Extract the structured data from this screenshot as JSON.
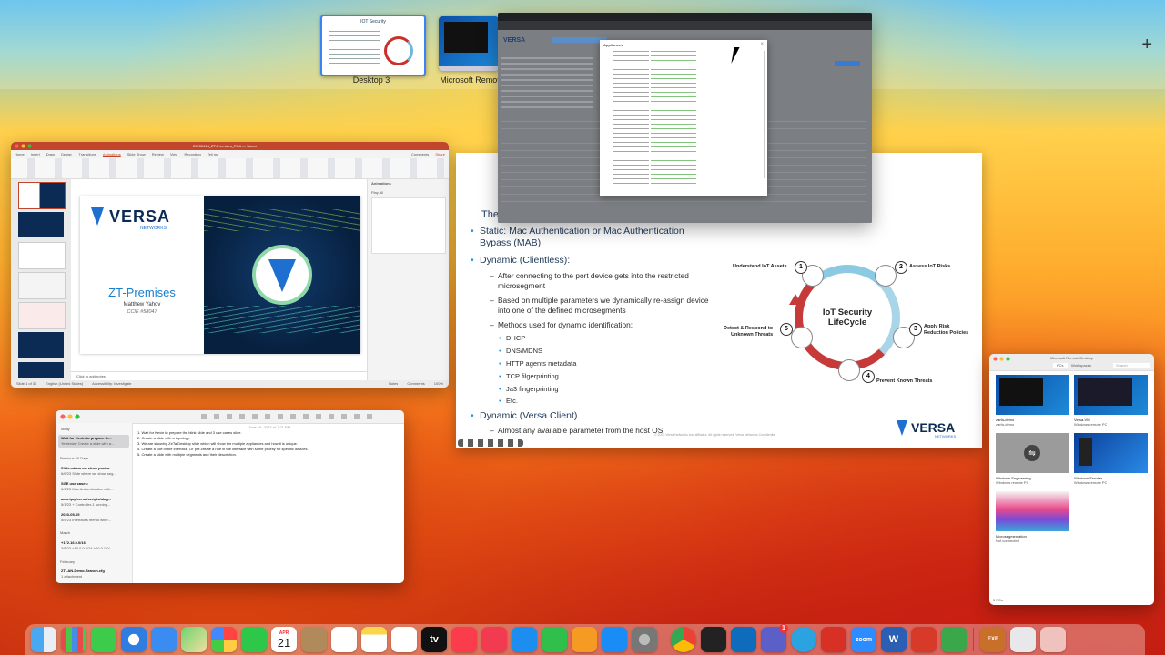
{
  "spaces": {
    "desktop3_label": "Desktop 3",
    "desktop3_thumb_title": "IOT Security",
    "remote_label": "Microsoft Remot",
    "add_space": "+"
  },
  "powerpoint": {
    "title": "20230418_ZT-Premises_RSA — Saved",
    "menu": [
      "Home",
      "Insert",
      "Draw",
      "Design",
      "Transitions",
      "Animations",
      "Slide Show",
      "Review",
      "View",
      "Recording",
      "Tell me"
    ],
    "comments": "Comments",
    "share": "Share",
    "pane_title": "Animations",
    "pane_play": "Play All",
    "slide_title": "ZT-Premises",
    "slide_author": "Matthew Yahov",
    "slide_ccie": "CCIE #58047",
    "notes_placeholder": "Click to add notes",
    "status_left": "Slide 1 of 30",
    "status_lang": "English (United States)",
    "status_access": "Accessibility: Investigate",
    "status_notes": "Notes",
    "status_comments": "Comments",
    "zoom": "100%",
    "logo_text": "VERSA",
    "logo_sub": "NETWORKS"
  },
  "slide": {
    "heading_partial": "The",
    "b1_line1": "Static: Mac Authentication or Mac Authentication",
    "b1_line2": "Bypass (MAB)",
    "b2": "Dynamic (Clientless):",
    "s1_line1": "After connecting to the port device gets into the restricted",
    "s1_line2": "microsegment",
    "s2_line1": "Based on multiple parameters we dynamically re-assign device",
    "s2_line2": "into one of the defined microsegments",
    "s3": "Methods used for dynamic identification:",
    "m1": "DHCP",
    "m2": "DNS/MDNS",
    "m3": "HTTP agents metadata",
    "m4": "TCP filgerprinting",
    "m5": "Ja3 fingerprinting",
    "m6": "Etc.",
    "b3": "Dynamic (Versa Client)",
    "s4": "Almost any available parameter from the host OS",
    "lifecycle_center1": "IoT Security",
    "lifecycle_center2": "LifeCycle",
    "lc1": "Understand IoT Assets",
    "lc2": "Assess IoT Risks",
    "lc3a": "Apply Risk",
    "lc3b": "Reduction Policies",
    "lc4": "Prevent Known Threats",
    "lc5a": "Detect & Respond to",
    "lc5b": "Unknown Threats",
    "n1": "1",
    "n2": "2",
    "n3": "3",
    "n4": "4",
    "n5": "5",
    "footer": "© 2023 Versa Networks and affiliates. All rights reserved. Versa Networks Confidential",
    "logo_text": "VERSA",
    "logo_sub": "NETWORKS"
  },
  "browser": {
    "logo": "VERSA",
    "popup_title": "Appliances"
  },
  "notes": {
    "date": "June 19, 2023 at 1:21 PM",
    "section_today": "Today",
    "section_prev30": "Previous 30 Days",
    "section_march": "March",
    "section_feb": "February",
    "items": [
      {
        "title": "Wait for Kevin to prepare th...",
        "sub": "Yesterday  Create a slide with a..."
      },
      {
        "title": "Slide where we show postur...",
        "sub": "6/6/23  Slide where we show seg..."
      },
      {
        "title": "SGE use cases:",
        "sub": "6/1/23  Mac Authentication with..."
      },
      {
        "title": "auto.ipqi/versa/scripts/alog...",
        "sub": "5/1/23  + Controller-1 running..."
      },
      {
        "title": "2023-05-05",
        "sub": "5/5/23  Interfaces memo wher..."
      },
      {
        "title": "+172.16.0.0/16",
        "sub": "3/8/23  +10.0.0.0/24 +10.0.1.0/..."
      },
      {
        "title": "ZTLAN-Demo-Branch.cfg",
        "sub": "1 attachment"
      }
    ],
    "body": [
      "1. Wait for Kevin to prepare the blink slide and 3 use cases slide.",
      "2. Create a slide with a topology.",
      "3. We are showing ZeTa Desktop slide which will show the multiple appliances and how it is unique.",
      "4. Create a role in the interface. Or pre-create a rule in the interface with some priority for specific devices.",
      "5. Create a slide with multiple segments and their description."
    ]
  },
  "rdp": {
    "title": "Microsoft Remote Desktop",
    "tab_pcs": "PCs",
    "tab_workspaces": "Workspaces",
    "search": "Search",
    "footer": "5 PCs",
    "pcs": [
      {
        "name": "zarfa-demo",
        "sub": "zarfa-demo"
      },
      {
        "name": "Versa-VM",
        "sub": "Windows remote PC"
      },
      {
        "name": "Windows Engineering",
        "sub": "Windows remote PC"
      },
      {
        "name": "Windows Frontier",
        "sub": "Windows remote PC"
      },
      {
        "name": "Microsegmentation",
        "sub": "Not connected"
      }
    ]
  },
  "dock": {
    "calendar_month": "APR",
    "calendar_day": "21",
    "tv": "tv",
    "zoom": "zoom",
    "w": "W",
    "teams_badge": "1",
    "exe": "EXE",
    "apps": [
      "Finder",
      "Launchpad",
      "Messages",
      "Safari",
      "Mail",
      "Maps",
      "Photos",
      "FaceTime",
      "Calendar",
      "Contacts",
      "Reminders",
      "Notes",
      "Freeform",
      "TV",
      "Music",
      "News",
      "Keynote",
      "Numbers",
      "Pages",
      "App Store",
      "System Settings",
      "Chrome",
      "Terminal",
      "Outlook",
      "Teams",
      "Telegram",
      "Acrobat",
      "Zoom",
      "Word",
      "Remote Desktop",
      "Cisco Webex",
      "Downloads",
      "Folder",
      "Trash"
    ]
  }
}
